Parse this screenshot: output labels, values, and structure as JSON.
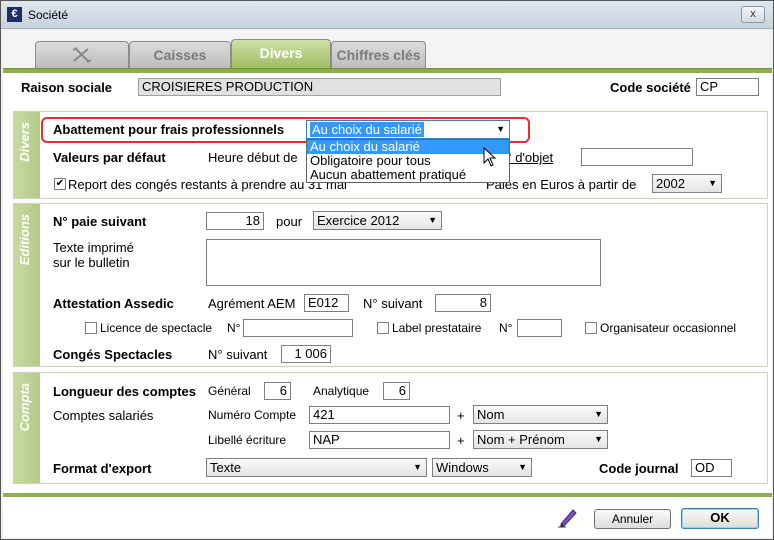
{
  "window": {
    "title": "Société",
    "close_label": "x",
    "app_icon": "€"
  },
  "tabs": [
    {
      "label": ""
    },
    {
      "label": "Caisses"
    },
    {
      "label": "Divers"
    },
    {
      "label": "Chiffres clés"
    }
  ],
  "active_tab": "Divers",
  "header": {
    "raison_sociale_label": "Raison sociale",
    "raison_sociale_value": "CROISIERES PRODUCTION",
    "code_societe_label": "Code société",
    "code_societe_value": "CP"
  },
  "divers": {
    "section_label": "Divers",
    "abattement_label": "Abattement pour frais professionnels",
    "abattement_value": "Au choix du salarié",
    "abattement_options": [
      "Au choix du salarié",
      "Obligatoire pour tous",
      "Aucun abattement pratiqué"
    ],
    "valeurs_label": "Valeurs par défaut",
    "heure_label": "Heure début de",
    "objet_label": "N° d'objet",
    "objet_value": "",
    "report_label": "Report des congés restants à prendre au 31 mai",
    "report_checked": true,
    "paies_label": "Paies en Euros à partir de",
    "paies_value": "2002"
  },
  "editions": {
    "section_label": "Editions",
    "paie_suivant_label": "N° paie suivant",
    "paie_suivant_value": "18",
    "pour_label": "pour",
    "exercice_value": "Exercice 2012",
    "texte_label_1": "Texte imprimé",
    "texte_label_2": "sur le bulletin",
    "texte_value": "",
    "assedic_label": "Attestation Assedic",
    "agrement_label": "Agrément AEM",
    "agrement_value": "E012",
    "no_suivant_label": "N° suivant",
    "no_suivant_value": "8",
    "licence_label": "Licence de spectacle",
    "licence_no_label": "N°",
    "licence_value": "",
    "label_presta_label": "Label prestataire",
    "label_presta_no_label": "N°",
    "label_presta_value": "",
    "organisateur_label": "Organisateur occasionnel",
    "conges_label": "Congés Spectacles",
    "conges_no_label": "N° suivant",
    "conges_value": "1 006"
  },
  "compta": {
    "section_label": "Compta",
    "longueur_label": "Longueur des comptes",
    "general_label": "Général",
    "general_value": "6",
    "analytique_label": "Analytique",
    "analytique_value": "6",
    "comptes_label": "Comptes salariés",
    "numero_label": "Numéro Compte",
    "numero_value": "421",
    "plus1": "+",
    "numero_combo": "Nom",
    "libelle_label": "Libellé écriture",
    "libelle_value": "NAP",
    "plus2": "+",
    "libelle_combo": "Nom + Prénom",
    "format_label": "Format d'export",
    "format_value": "Texte",
    "format_os": "Windows",
    "journal_label": "Code journal",
    "journal_value": "OD"
  },
  "footer": {
    "cancel_label": "Annuler",
    "ok_label": "OK"
  }
}
